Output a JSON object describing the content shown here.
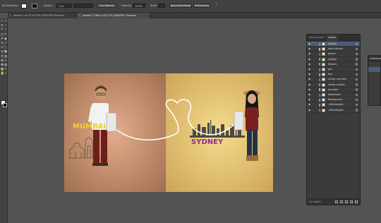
{
  "colors": {
    "workspace": "#535353",
    "panel": "#3b3b3b",
    "selected_row": "#4b5d78",
    "left_half": "#d09a7a",
    "right_half": "#efd07c",
    "title_yellow": "#f3d12a",
    "title_purple": "#8e2c8e"
  },
  "control_bar": {
    "selection": "No Selection",
    "stroke_label": "Stroke:",
    "stroke_value": "1 pt",
    "stroke_style": "5 pt. Round",
    "opacity_label": "Opacity:",
    "opacity_value": "100%",
    "style_label": "Style:",
    "document_setup": "Document Setup",
    "preferences": "Preferences"
  },
  "tabs": [
    {
      "label": "doodle 1.ai* @ 33.33% (RGB/GPU Preview)"
    },
    {
      "label": "doodle 2 FINAL.ai @ 25% (RGB/GPU Preview)"
    }
  ],
  "tools": [
    "selection-tool",
    "direct-selection-tool",
    "pen-tool",
    "curvature-tool",
    "type-tool",
    "line-tool",
    "rectangle-tool",
    "paintbrush-tool",
    "pencil-tool",
    "eraser-tool",
    "rotate-tool",
    "scale-tool",
    "width-tool",
    "free-transform-tool",
    "shape-builder-tool",
    "perspective-tool",
    "mesh-tool",
    "gradient-tool",
    "eyedropper-tool",
    "blend-tool",
    "symbol-sprayer-tool",
    "column-graph-tool",
    "artboard-tool",
    "slice-tool",
    "hand-tool",
    "zoom-tool"
  ],
  "tool_glyphs": [
    "↖",
    "↗",
    "✒",
    "~",
    "T",
    "/",
    "□",
    "✎",
    "✐",
    "◆",
    "↻",
    "⤢",
    "≈",
    "⬚",
    "◎",
    "▦",
    "#",
    "▤",
    "✚",
    "∞",
    "✱",
    "▥",
    "▣",
    "✂",
    "✋",
    "⌕"
  ],
  "artboard": {
    "left_title": "MUMBAI",
    "right_title": "SYDNEY"
  },
  "layers_panel": {
    "tabs": [
      "Asset Export",
      "Layers"
    ],
    "rows": [
      {
        "name": "sydney",
        "swatch": "#4a9bf0",
        "selected": true
      },
      {
        "name": "heart phone",
        "swatch": "#f0c020",
        "selected": false
      },
      {
        "name": "phone",
        "swatch": "#e04040",
        "selected": false
      },
      {
        "name": "sydney",
        "swatch": "#40c040",
        "selected": false
      },
      {
        "name": "flowers",
        "swatch": "#40a0f0",
        "selected": false
      },
      {
        "name": "girl",
        "swatch": "#e040a0",
        "selected": false
      },
      {
        "name": "boy",
        "swatch": "#f08030",
        "selected": false
      },
      {
        "name": "vector mumbai",
        "swatch": "#a040e0",
        "selected": false
      },
      {
        "name": "vector sydney",
        "swatch": "#30b0b0",
        "selected": false
      },
      {
        "name": "mumbai",
        "swatch": "#b0b0b0",
        "selected": false
      },
      {
        "name": "distressed",
        "swatch": "#6060e0",
        "selected": false
      },
      {
        "name": "Background",
        "swatch": "#4a9bf0",
        "selected": false
      },
      {
        "name": "<Rectangle>",
        "swatch": "#e08020",
        "selected": false
      },
      {
        "name": "<Rectangle>",
        "swatch": "#d04040",
        "selected": false
      }
    ],
    "footer_count": "11 Layers"
  },
  "artboards_panel": {
    "title": "Artboards"
  }
}
